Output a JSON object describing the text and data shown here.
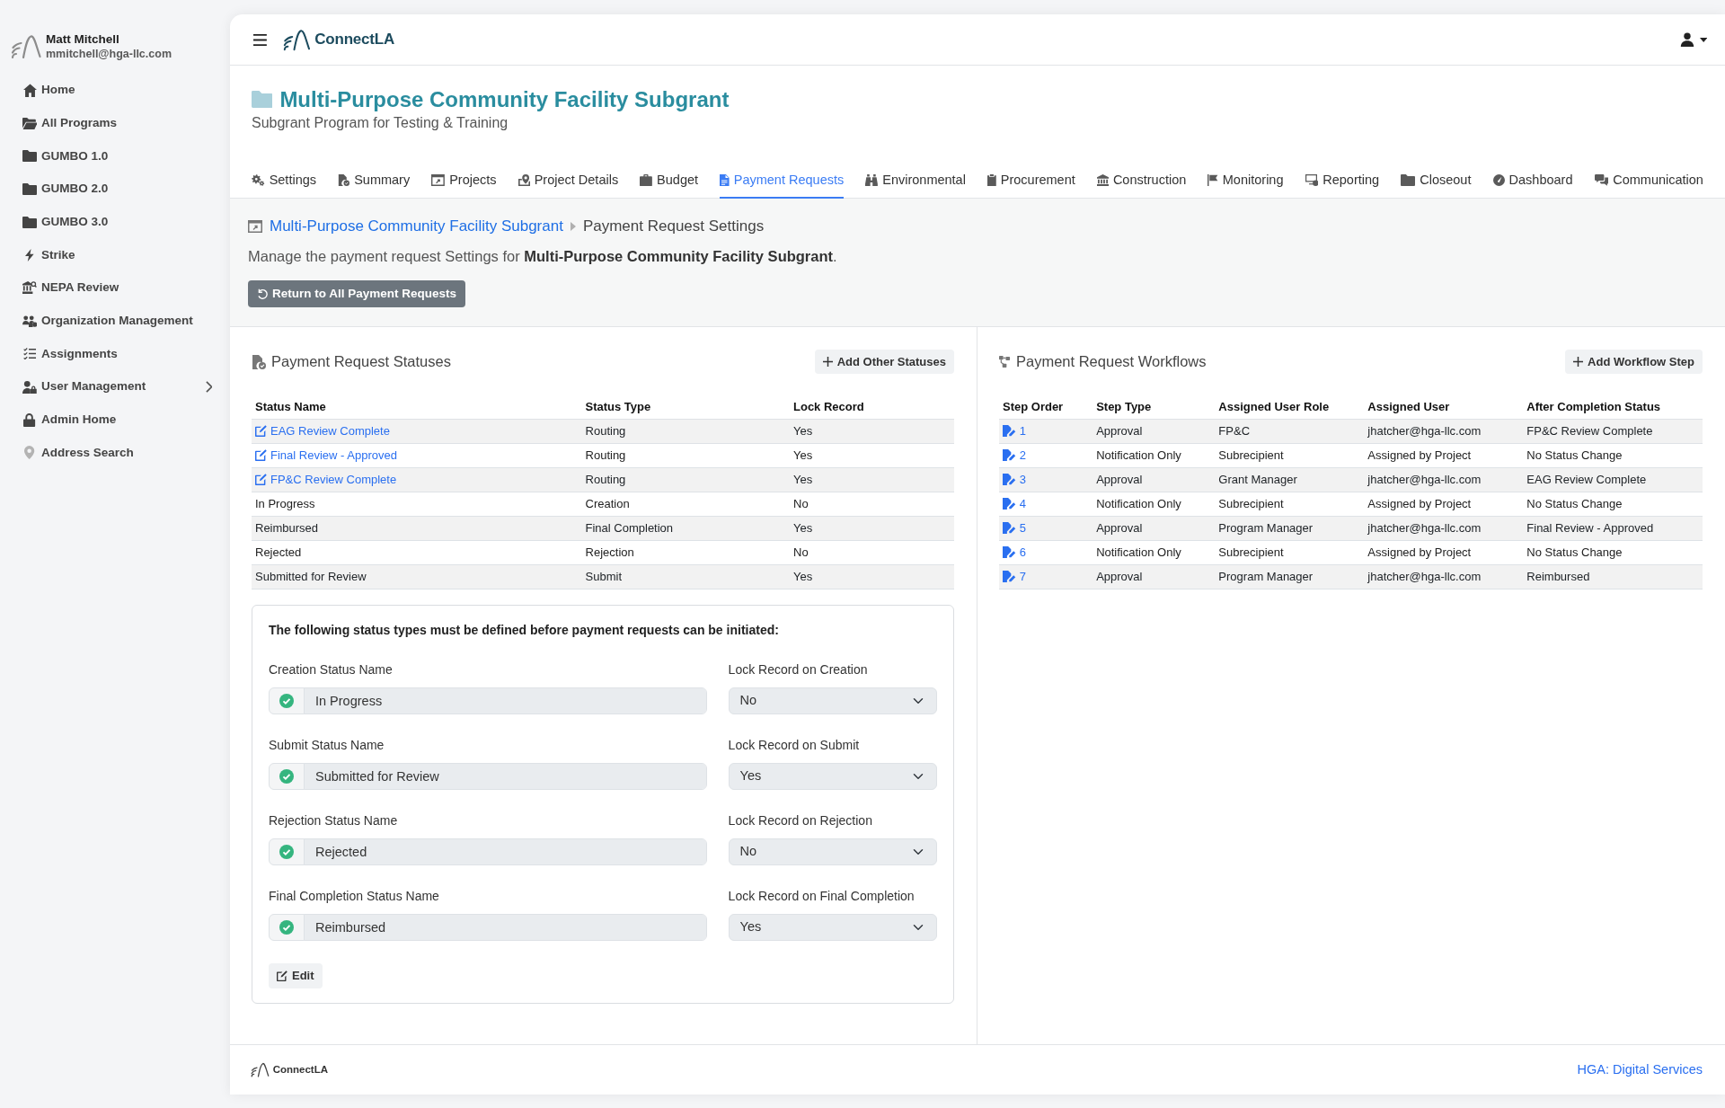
{
  "sidebar": {
    "user": {
      "name": "Matt Mitchell",
      "email": "mmitchell@hga-llc.com"
    },
    "items": [
      {
        "label": "Home"
      },
      {
        "label": "All Programs"
      },
      {
        "label": "GUMBO 1.0"
      },
      {
        "label": "GUMBO 2.0"
      },
      {
        "label": "GUMBO 3.0"
      },
      {
        "label": "Strike"
      },
      {
        "label": "NEPA Review"
      },
      {
        "label": "Organization Management"
      },
      {
        "label": "Assignments"
      },
      {
        "label": "User Management",
        "expanded": false
      },
      {
        "label": "Admin Home"
      },
      {
        "label": "Address Search"
      }
    ]
  },
  "header": {
    "brand": "ConnectLA"
  },
  "program": {
    "title": "Multi-Purpose Community Facility Subgrant",
    "subtitle": "Subgrant Program for Testing & Training"
  },
  "tabs": [
    {
      "label": "Settings",
      "selected": false
    },
    {
      "label": "Summary",
      "selected": false
    },
    {
      "label": "Projects",
      "selected": false
    },
    {
      "label": "Project Details",
      "selected": false
    },
    {
      "label": "Budget",
      "selected": false
    },
    {
      "label": "Payment Requests",
      "selected": true
    },
    {
      "label": "Environmental",
      "selected": false
    },
    {
      "label": "Procurement",
      "selected": false
    },
    {
      "label": "Construction",
      "selected": false
    },
    {
      "label": "Monitoring",
      "selected": false
    },
    {
      "label": "Reporting",
      "selected": false
    },
    {
      "label": "Closeout",
      "selected": false
    },
    {
      "label": "Dashboard",
      "selected": false
    },
    {
      "label": "Communication",
      "selected": false
    }
  ],
  "breadcrumb": [
    {
      "label": "Multi-Purpose Community Facility Subgrant",
      "active": false
    },
    {
      "label": "Payment Request Settings",
      "active": true
    }
  ],
  "description": "Manage the payment request Settings for **Multi-Purpose Community Facility Subgrant**.",
  "return_button": "Return to All Payment Requests",
  "statuses": {
    "title": "Payment Request Statuses",
    "add_button": "Add Other Statuses",
    "columns": [
      "Status Name",
      "Status Type",
      "Lock Record"
    ],
    "rows": [
      {
        "editable": true,
        "cells": [
          "EAG Review Complete",
          "Routing",
          "Yes"
        ]
      },
      {
        "editable": true,
        "cells": [
          "Final Review - Approved",
          "Routing",
          "Yes"
        ]
      },
      {
        "editable": true,
        "cells": [
          "FP&C Review Complete",
          "Routing",
          "Yes"
        ]
      },
      {
        "editable": false,
        "cells": [
          "In Progress",
          "Creation",
          "No"
        ]
      },
      {
        "editable": false,
        "cells": [
          "Reimbursed",
          "Final Completion",
          "Yes"
        ]
      },
      {
        "editable": false,
        "cells": [
          "Rejected",
          "Rejection",
          "No"
        ]
      },
      {
        "editable": false,
        "cells": [
          "Submitted for Review",
          "Submit",
          "Yes"
        ]
      }
    ]
  },
  "required_statuses": {
    "heading": "The following status types must be defined before payment requests can be initiated:",
    "fields": [
      {
        "label": "Creation Status Name",
        "value": "In Progress",
        "defined": true,
        "lock_label": "Lock Record on Creation",
        "lock_value": "No"
      },
      {
        "label": "Submit Status Name",
        "value": "Submitted for Review",
        "defined": true,
        "lock_label": "Lock Record on Submit",
        "lock_value": "Yes"
      },
      {
        "label": "Rejection Status Name",
        "value": "Rejected",
        "defined": true,
        "lock_label": "Lock Record on Rejection",
        "lock_value": "No"
      },
      {
        "label": "Final Completion Status Name",
        "value": "Reimbursed",
        "defined": true,
        "lock_label": "Lock Record on Final Completion",
        "lock_value": "Yes"
      }
    ],
    "edit_button": "Edit"
  },
  "workflows": {
    "title": "Payment Request Workflows",
    "add_button": "Add Workflow Step",
    "columns": [
      "Step Order",
      "Step Type",
      "Assigned User Role",
      "Assigned User",
      "After Completion Status"
    ],
    "rows": [
      [
        "1",
        "Approval",
        "FP&C",
        "jhatcher@hga-llc.com",
        "FP&C Review Complete"
      ],
      [
        "2",
        "Notification Only",
        "Subrecipient",
        "Assigned by Project",
        "No Status Change"
      ],
      [
        "3",
        "Approval",
        "Grant Manager",
        "jhatcher@hga-llc.com",
        "EAG Review Complete"
      ],
      [
        "4",
        "Notification Only",
        "Subrecipient",
        "Assigned by Project",
        "No Status Change"
      ],
      [
        "5",
        "Approval",
        "Program Manager",
        "jhatcher@hga-llc.com",
        "Final Review - Approved"
      ],
      [
        "6",
        "Notification Only",
        "Subrecipient",
        "Assigned by Project",
        "No Status Change"
      ],
      [
        "7",
        "Approval",
        "Program Manager",
        "jhatcher@hga-llc.com",
        "Reimbursed"
      ]
    ]
  },
  "footer": {
    "brand": "ConnectLA",
    "link": "HGA: Digital Services"
  }
}
